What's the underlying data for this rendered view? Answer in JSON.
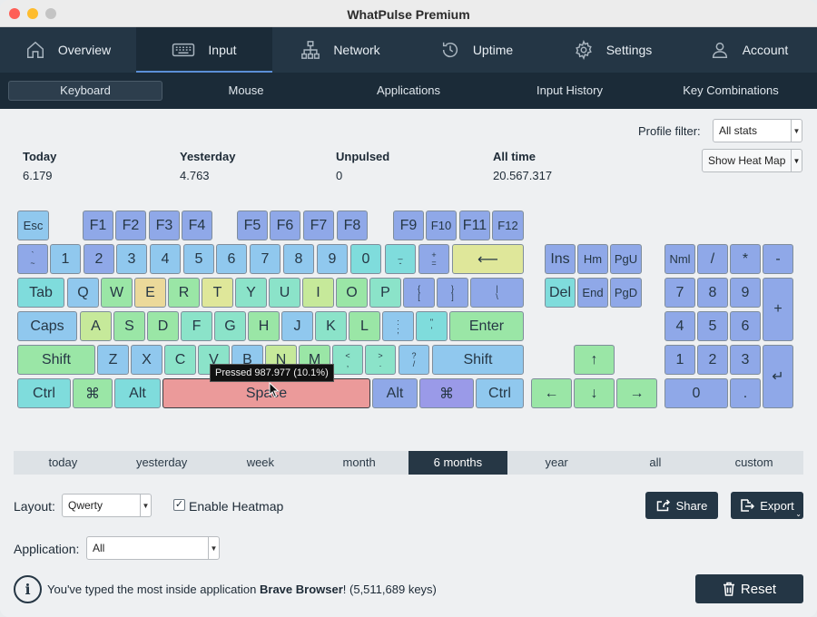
{
  "window": {
    "title": "WhatPulse Premium"
  },
  "mainnav": [
    {
      "label": "Overview",
      "icon": "home-icon"
    },
    {
      "label": "Input",
      "icon": "keyboard-icon"
    },
    {
      "label": "Network",
      "icon": "network-icon"
    },
    {
      "label": "Uptime",
      "icon": "uptime-icon"
    },
    {
      "label": "Settings",
      "icon": "gear-icon"
    },
    {
      "label": "Account",
      "icon": "user-icon"
    }
  ],
  "subnav": [
    "Keyboard",
    "Mouse",
    "Applications",
    "Input History",
    "Key Combinations"
  ],
  "profile": {
    "label": "Profile filter:",
    "value": "All stats",
    "heatmap_button": "Show Heat Map"
  },
  "stats": {
    "today": {
      "label": "Today",
      "value": "6.179"
    },
    "yesterday": {
      "label": "Yesterday",
      "value": "4.763"
    },
    "unpulsed": {
      "label": "Unpulsed",
      "value": "0"
    },
    "alltime": {
      "label": "All time",
      "value": "20.567.317"
    }
  },
  "keys": {
    "esc": "Esc",
    "f1": "F1",
    "f2": "F2",
    "f3": "F3",
    "f4": "F4",
    "f5": "F5",
    "f6": "F6",
    "f7": "F7",
    "f8": "F8",
    "f9": "F9",
    "f10": "F10",
    "f11": "F11",
    "f12": "F12",
    "backtick_top": "`",
    "backtick_bot": "~",
    "n1": "1",
    "n2": "2",
    "n3": "3",
    "n4": "4",
    "n5": "5",
    "n6": "6",
    "n7": "7",
    "n8": "8",
    "n9": "9",
    "n0": "0",
    "minus_top": "_",
    "minus_bot": "-",
    "equal_top": "+",
    "equal_bot": "=",
    "backspace": "⟵",
    "tab": "Tab",
    "q": "Q",
    "w": "W",
    "e": "E",
    "r": "R",
    "t": "T",
    "y": "Y",
    "u": "U",
    "i": "I",
    "o": "O",
    "p": "P",
    "lbr_top": "{",
    "lbr_bot": "[",
    "rbr_top": "}",
    "rbr_bot": "]",
    "bsl_top": "|",
    "bsl_bot": "\\",
    "caps": "Caps",
    "a": "A",
    "s": "S",
    "d": "D",
    "f": "F",
    "g": "G",
    "h": "H",
    "j": "J",
    "k": "K",
    "l": "L",
    "semi_top": ":",
    "semi_bot": ";",
    "quote_top": "\"",
    "quote_bot": "'",
    "enter": "Enter",
    "shift_l": "Shift",
    "z": "Z",
    "x": "X",
    "c": "C",
    "v": "V",
    "b": "B",
    "n": "N",
    "m": "M",
    "comma_top": "<",
    "comma_bot": ",",
    "period_top": ">",
    "period_bot": ".",
    "slash_top": "?",
    "slash_bot": "/",
    "shift_r": "Shift",
    "ctrl_l": "Ctrl",
    "cmd_l": "⌘",
    "alt_l": "Alt",
    "space": "Space",
    "alt_r": "Alt",
    "cmd_r": "⌘",
    "ctrl_r": "Ctrl",
    "ins": "Ins",
    "hm": "Hm",
    "pgu": "PgU",
    "del": "Del",
    "end": "End",
    "pgd": "PgD",
    "up": "↑",
    "left": "←",
    "down": "↓",
    "right": "→",
    "nml": "Nml",
    "kp_div": "/",
    "kp_mul": "*",
    "kp_sub": "-",
    "kp_add": "+",
    "kp7": "7",
    "kp8": "8",
    "kp9": "9",
    "kp4": "4",
    "kp5": "5",
    "kp6": "6",
    "kp1": "1",
    "kp2": "2",
    "kp3": "3",
    "kp0": "0",
    "kp_dot": ".",
    "kp_enter": "↵"
  },
  "tooltip": "Pressed 987.977 (10.1%)",
  "periods": [
    "today",
    "yesterday",
    "week",
    "month",
    "6 months",
    "year",
    "all",
    "custom"
  ],
  "active_period": "6 months",
  "layout": {
    "label": "Layout:",
    "value": "Qwerty"
  },
  "heatmap": {
    "label": "Enable Heatmap",
    "checked": true,
    "mark": "✓"
  },
  "application": {
    "label": "Application:",
    "value": "All"
  },
  "buttons": {
    "share": "Share",
    "export": "Export",
    "reset": "Reset"
  },
  "info": {
    "prefix": "You've typed the most inside application ",
    "app": "Brave Browser",
    "suffix": "! (5,511,689 keys)"
  },
  "colors": {
    "nav_bg": "#243645",
    "subnav_bg": "#1b2b38",
    "accent": "#5b8fd6"
  }
}
